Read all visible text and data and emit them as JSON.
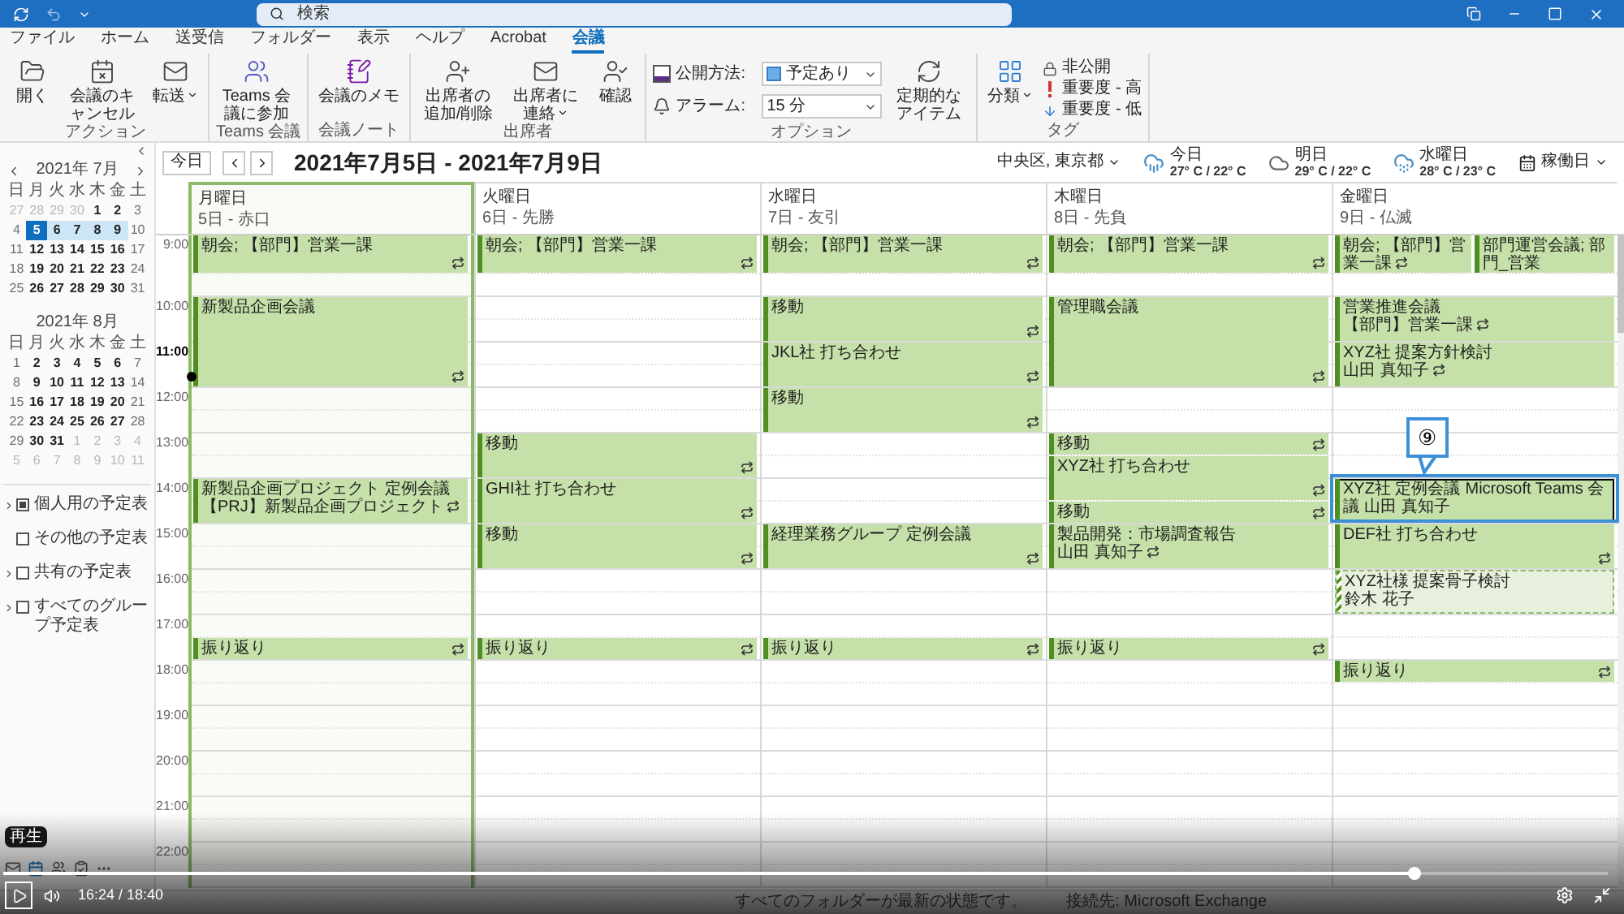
{
  "title_bar": {
    "search": {
      "placeholder": "検索"
    }
  },
  "menu_tabs": [
    {
      "label": "ファイル",
      "selected": false
    },
    {
      "label": "ホーム",
      "selected": false
    },
    {
      "label": "送受信",
      "selected": false
    },
    {
      "label": "フォルダー",
      "selected": false
    },
    {
      "label": "表示",
      "selected": false
    },
    {
      "label": "ヘルプ",
      "selected": false
    },
    {
      "label": "Acrobat",
      "selected": false
    },
    {
      "label": "会議",
      "selected": true
    }
  ],
  "ribbon": {
    "groups": [
      {
        "label": "アクション",
        "buttons": [
          {
            "label": "開く",
            "menu": false
          },
          {
            "label": "会議のキャンセル",
            "menu": false
          },
          {
            "label": "転送",
            "menu": true
          }
        ]
      },
      {
        "label": "Teams 会議",
        "buttons": [
          {
            "label": "Teams 会議に参加",
            "menu": false
          }
        ]
      },
      {
        "label": "会議ノート",
        "buttons": [
          {
            "label": "会議のメモ",
            "menu": false
          }
        ]
      },
      {
        "label": "出席者",
        "buttons": [
          {
            "label": "出席者の追加/削除",
            "menu": false
          },
          {
            "label": "出席者に連絡",
            "menu": true
          },
          {
            "label": "確認",
            "menu": false
          }
        ]
      },
      {
        "label": "オプション",
        "fields": [
          {
            "label": "公開方法:",
            "value": "予定あり"
          },
          {
            "label": "アラーム:",
            "value": "15 分"
          }
        ],
        "buttons": [
          {
            "label": "定期的なアイテム",
            "menu": false
          }
        ]
      },
      {
        "label": "タグ",
        "buttons": [
          {
            "label": "分類",
            "menu": true
          }
        ],
        "small_buttons": [
          {
            "label": "非公開"
          },
          {
            "label": "重要度 - 高"
          },
          {
            "label": "重要度 - 低"
          }
        ]
      }
    ]
  },
  "mini_calendars": [
    {
      "title": "2021年 7月",
      "navigation": true,
      "weekdays": [
        "日",
        "月",
        "火",
        "水",
        "木",
        "金",
        "土"
      ],
      "weeks": [
        [
          {
            "text": "27",
            "in_month": false,
            "selected": false,
            "today": false
          },
          {
            "text": "28",
            "in_month": false,
            "selected": false,
            "today": false
          },
          {
            "text": "29",
            "in_month": false,
            "selected": false,
            "today": false
          },
          {
            "text": "30",
            "in_month": false,
            "selected": false,
            "today": false
          },
          {
            "text": "1",
            "in_month": true,
            "selected": false,
            "today": false
          },
          {
            "text": "2",
            "in_month": true,
            "selected": false,
            "today": false
          },
          {
            "text": "3",
            "in_month": true,
            "selected": false,
            "today": false
          }
        ],
        [
          {
            "text": "4",
            "in_month": true,
            "selected": false,
            "today": false
          },
          {
            "text": "5",
            "in_month": true,
            "selected": true,
            "today": true
          },
          {
            "text": "6",
            "in_month": true,
            "selected": true,
            "today": false
          },
          {
            "text": "7",
            "in_month": true,
            "selected": true,
            "today": false
          },
          {
            "text": "8",
            "in_month": true,
            "selected": true,
            "today": false
          },
          {
            "text": "9",
            "in_month": true,
            "selected": true,
            "today": false
          },
          {
            "text": "10",
            "in_month": true,
            "selected": false,
            "today": false
          }
        ],
        [
          {
            "text": "11",
            "in_month": true,
            "selected": false,
            "today": false
          },
          {
            "text": "12",
            "in_month": true,
            "selected": false,
            "today": false
          },
          {
            "text": "13",
            "in_month": true,
            "selected": false,
            "today": false
          },
          {
            "text": "14",
            "in_month": true,
            "selected": false,
            "today": false
          },
          {
            "text": "15",
            "in_month": true,
            "selected": false,
            "today": false
          },
          {
            "text": "16",
            "in_month": true,
            "selected": false,
            "today": false
          },
          {
            "text": "17",
            "in_month": true,
            "selected": false,
            "today": false
          }
        ],
        [
          {
            "text": "18",
            "in_month": true,
            "selected": false,
            "today": false
          },
          {
            "text": "19",
            "in_month": true,
            "selected": false,
            "today": false
          },
          {
            "text": "20",
            "in_month": true,
            "selected": false,
            "today": false
          },
          {
            "text": "21",
            "in_month": true,
            "selected": false,
            "today": false
          },
          {
            "text": "22",
            "in_month": true,
            "selected": false,
            "today": false
          },
          {
            "text": "23",
            "in_month": true,
            "selected": false,
            "today": false
          },
          {
            "text": "24",
            "in_month": true,
            "selected": false,
            "today": false
          }
        ],
        [
          {
            "text": "25",
            "in_month": true,
            "selected": false,
            "today": false
          },
          {
            "text": "26",
            "in_month": true,
            "selected": false,
            "today": false
          },
          {
            "text": "27",
            "in_month": true,
            "selected": false,
            "today": false
          },
          {
            "text": "28",
            "in_month": true,
            "selected": false,
            "today": false
          },
          {
            "text": "29",
            "in_month": true,
            "selected": false,
            "today": false
          },
          {
            "text": "30",
            "in_month": true,
            "selected": false,
            "today": false
          },
          {
            "text": "31",
            "in_month": true,
            "selected": false,
            "today": false
          }
        ]
      ]
    },
    {
      "title": "2021年 8月",
      "navigation": false,
      "weekdays": [
        "日",
        "月",
        "火",
        "水",
        "木",
        "金",
        "土"
      ],
      "weeks": [
        [
          {
            "text": "1",
            "in_month": true,
            "selected": false,
            "today": false
          },
          {
            "text": "2",
            "in_month": true,
            "selected": false,
            "today": false
          },
          {
            "text": "3",
            "in_month": true,
            "selected": false,
            "today": false
          },
          {
            "text": "4",
            "in_month": true,
            "selected": false,
            "today": false
          },
          {
            "text": "5",
            "in_month": true,
            "selected": false,
            "today": false
          },
          {
            "text": "6",
            "in_month": true,
            "selected": false,
            "today": false
          },
          {
            "text": "7",
            "in_month": true,
            "selected": false,
            "today": false
          }
        ],
        [
          {
            "text": "8",
            "in_month": true,
            "selected": false,
            "today": false
          },
          {
            "text": "9",
            "in_month": true,
            "selected": false,
            "today": false
          },
          {
            "text": "10",
            "in_month": true,
            "selected": false,
            "today": false
          },
          {
            "text": "11",
            "in_month": true,
            "selected": false,
            "today": false
          },
          {
            "text": "12",
            "in_month": true,
            "selected": false,
            "today": false
          },
          {
            "text": "13",
            "in_month": true,
            "selected": false,
            "today": false
          },
          {
            "text": "14",
            "in_month": true,
            "selected": false,
            "today": false
          }
        ],
        [
          {
            "text": "15",
            "in_month": true,
            "selected": false,
            "today": false
          },
          {
            "text": "16",
            "in_month": true,
            "selected": false,
            "today": false
          },
          {
            "text": "17",
            "in_month": true,
            "selected": false,
            "today": false
          },
          {
            "text": "18",
            "in_month": true,
            "selected": false,
            "today": false
          },
          {
            "text": "19",
            "in_month": true,
            "selected": false,
            "today": false
          },
          {
            "text": "20",
            "in_month": true,
            "selected": false,
            "today": false
          },
          {
            "text": "21",
            "in_month": true,
            "selected": false,
            "today": false
          }
        ],
        [
          {
            "text": "22",
            "in_month": true,
            "selected": false,
            "today": false
          },
          {
            "text": "23",
            "in_month": true,
            "selected": false,
            "today": false
          },
          {
            "text": "24",
            "in_month": true,
            "selected": false,
            "today": false
          },
          {
            "text": "25",
            "in_month": true,
            "selected": false,
            "today": false
          },
          {
            "text": "26",
            "in_month": true,
            "selected": false,
            "today": false
          },
          {
            "text": "27",
            "in_month": true,
            "selected": false,
            "today": false
          },
          {
            "text": "28",
            "in_month": true,
            "selected": false,
            "today": false
          }
        ],
        [
          {
            "text": "29",
            "in_month": true,
            "selected": false,
            "today": false
          },
          {
            "text": "30",
            "in_month": true,
            "selected": false,
            "today": false
          },
          {
            "text": "31",
            "in_month": true,
            "selected": false,
            "today": false
          },
          {
            "text": "1",
            "in_month": false,
            "selected": false,
            "today": false
          },
          {
            "text": "2",
            "in_month": false,
            "selected": false,
            "today": false
          },
          {
            "text": "3",
            "in_month": false,
            "selected": false,
            "today": false
          },
          {
            "text": "4",
            "in_month": false,
            "selected": false,
            "today": false
          }
        ],
        [
          {
            "text": "5",
            "in_month": false,
            "selected": false,
            "today": false
          },
          {
            "text": "6",
            "in_month": false,
            "selected": false,
            "today": false
          },
          {
            "text": "7",
            "in_month": false,
            "selected": false,
            "today": false
          },
          {
            "text": "8",
            "in_month": false,
            "selected": false,
            "today": false
          },
          {
            "text": "9",
            "in_month": false,
            "selected": false,
            "today": false
          },
          {
            "text": "10",
            "in_month": false,
            "selected": false,
            "today": false
          },
          {
            "text": "11",
            "in_month": false,
            "selected": false,
            "today": false
          }
        ]
      ]
    }
  ],
  "calendar_folders": [
    {
      "label": "個人用の予定表",
      "checked": true,
      "expandable": true
    },
    {
      "label": "その他の予定表",
      "checked": false,
      "expandable": false
    },
    {
      "label": "共有の予定表",
      "checked": false,
      "expandable": true
    },
    {
      "label": "すべてのグループ予定表",
      "checked": false,
      "expandable": true
    }
  ],
  "toolbar": {
    "today": "今日",
    "range": "2021年7月5日 - 2021年7月9日",
    "location": "中央区, 東京都",
    "weather": [
      {
        "day": "今日",
        "temp": "27° C / 22° C"
      },
      {
        "day": "明日",
        "temp": "29° C / 22° C"
      },
      {
        "day": "水曜日",
        "temp": "28° C / 23° C"
      }
    ],
    "view": "稼働日"
  },
  "times": [
    {
      "text": "9:00",
      "current": false
    },
    {
      "text": "10:00",
      "current": false
    },
    {
      "text": "11:00",
      "current": true
    },
    {
      "text": "12:00",
      "current": false
    },
    {
      "text": "13:00",
      "current": false
    },
    {
      "text": "14:00",
      "current": false
    },
    {
      "text": "15:00",
      "current": false
    },
    {
      "text": "16:00",
      "current": false
    },
    {
      "text": "17:00",
      "current": false
    },
    {
      "text": "18:00",
      "current": false
    },
    {
      "text": "19:00",
      "current": false
    },
    {
      "text": "20:00",
      "current": false
    },
    {
      "text": "21:00",
      "current": false
    },
    {
      "text": "22:00",
      "current": false
    }
  ],
  "days": [
    {
      "weekday": "月曜日",
      "date": "5日 - 赤口",
      "today": true,
      "slots": [
        {
          "kind": "busy",
          "lines": [
            "朝会; 【部門】営業一課"
          ],
          "recurring": true,
          "selected": false
        },
        {
          "kind": "free"
        },
        {
          "kind": "busy",
          "lines": [
            "新製品企画会議"
          ],
          "recurring": true,
          "selected": false
        },
        {
          "kind": "continued"
        },
        {
          "kind": "continued"
        },
        {
          "kind": "continued"
        },
        {
          "kind": "free"
        },
        {
          "kind": "free"
        },
        {
          "kind": "free"
        },
        {
          "kind": "free"
        },
        {
          "kind": "busy",
          "lines": [
            "新製品企画プロジェクト 定例会議",
            "【PRJ】新製品企画プロジェクト"
          ],
          "recurring": true,
          "selected": false
        },
        {
          "kind": "continued"
        },
        {
          "kind": "free"
        },
        {
          "kind": "free"
        },
        {
          "kind": "free"
        },
        {
          "kind": "free"
        },
        {
          "kind": "free"
        },
        {
          "kind": "busy",
          "lines": [
            "振り返り"
          ],
          "recurring": true,
          "selected": false
        }
      ]
    },
    {
      "weekday": "火曜日",
      "date": "6日 - 先勝",
      "today": false,
      "slots": [
        {
          "kind": "busy",
          "lines": [
            "朝会; 【部門】営業一課"
          ],
          "recurring": true,
          "selected": false
        },
        {
          "kind": "free"
        },
        {
          "kind": "free"
        },
        {
          "kind": "free"
        },
        {
          "kind": "free"
        },
        {
          "kind": "free"
        },
        {
          "kind": "free"
        },
        {
          "kind": "free"
        },
        {
          "kind": "busy",
          "lines": [
            "移動"
          ],
          "recurring": true,
          "selected": false
        },
        {
          "kind": "continued"
        },
        {
          "kind": "busy",
          "lines": [
            "GHI社 打ち合わせ"
          ],
          "recurring": true,
          "selected": false
        },
        {
          "kind": "continued"
        },
        {
          "kind": "busy",
          "lines": [
            "移動"
          ],
          "recurring": true,
          "selected": false
        },
        {
          "kind": "continued"
        },
        {
          "kind": "free"
        },
        {
          "kind": "free"
        },
        {
          "kind": "free"
        },
        {
          "kind": "busy",
          "lines": [
            "振り返り"
          ],
          "recurring": true,
          "selected": false
        }
      ]
    },
    {
      "weekday": "水曜日",
      "date": "7日 - 友引",
      "today": false,
      "slots": [
        {
          "kind": "busy",
          "lines": [
            "朝会; 【部門】営業一課"
          ],
          "recurring": true,
          "selected": false
        },
        {
          "kind": "free"
        },
        {
          "kind": "busy",
          "lines": [
            "移動"
          ],
          "recurring": true,
          "selected": false
        },
        {
          "kind": "continued"
        },
        {
          "kind": "busy",
          "lines": [
            "JKL社 打ち合わせ"
          ],
          "recurring": true,
          "selected": false
        },
        {
          "kind": "continued"
        },
        {
          "kind": "busy",
          "lines": [
            "移動"
          ],
          "recurring": true,
          "selected": false
        },
        {
          "kind": "continued"
        },
        {
          "kind": "free"
        },
        {
          "kind": "free"
        },
        {
          "kind": "free"
        },
        {
          "kind": "free"
        },
        {
          "kind": "busy",
          "lines": [
            "経理業務グループ 定例会議"
          ],
          "recurring": true,
          "selected": false
        },
        {
          "kind": "continued"
        },
        {
          "kind": "free"
        },
        {
          "kind": "free"
        },
        {
          "kind": "free"
        },
        {
          "kind": "busy",
          "lines": [
            "振り返り"
          ],
          "recurring": true,
          "selected": false
        }
      ]
    },
    {
      "weekday": "木曜日",
      "date": "8日 - 先負",
      "today": false,
      "slots": [
        {
          "kind": "busy",
          "lines": [
            "朝会; 【部門】営業一課"
          ],
          "recurring": true,
          "selected": false
        },
        {
          "kind": "free"
        },
        {
          "kind": "busy",
          "lines": [
            "管理職会議"
          ],
          "recurring": true,
          "selected": false
        },
        {
          "kind": "continued"
        },
        {
          "kind": "continued"
        },
        {
          "kind": "continued"
        },
        {
          "kind": "free"
        },
        {
          "kind": "free"
        },
        {
          "kind": "busy",
          "lines": [
            "移動"
          ],
          "recurring": true,
          "selected": false
        },
        {
          "kind": "busy",
          "lines": [
            "XYZ社 打ち合わせ"
          ],
          "recurring": true,
          "selected": false
        },
        {
          "kind": "continued"
        },
        {
          "kind": "busy",
          "lines": [
            "移動"
          ],
          "recurring": true,
          "selected": false
        },
        {
          "kind": "busy",
          "lines": [
            "製品開発：市場調査報告",
            "山田 真知子"
          ],
          "recurring": true,
          "selected": false
        },
        {
          "kind": "continued"
        },
        {
          "kind": "free"
        },
        {
          "kind": "free"
        },
        {
          "kind": "free"
        },
        {
          "kind": "busy",
          "lines": [
            "振り返り"
          ],
          "recurring": true,
          "selected": false
        }
      ]
    },
    {
      "weekday": "金曜日",
      "date": "9日 - 仏滅",
      "today": false,
      "slots": [
        {
          "kind": "split",
          "events": [
            {
              "kind": "busy",
              "lines": [
                "朝会; 【部門】営業一課"
              ],
              "recurring": true,
              "selected": false
            },
            {
              "kind": "busy",
              "lines": [
                "部門運営会議; 部門_営業"
              ],
              "recurring": false,
              "selected": false
            }
          ]
        },
        {
          "kind": "free"
        },
        {
          "kind": "busy",
          "lines": [
            "営業推進会議",
            "【部門】営業一課"
          ],
          "recurring": true,
          "selected": false
        },
        {
          "kind": "continued"
        },
        {
          "kind": "busy",
          "lines": [
            "XYZ社 提案方針検討",
            "山田 真知子"
          ],
          "recurring": true,
          "selected": false
        },
        {
          "kind": "continued"
        },
        {
          "kind": "free"
        },
        {
          "kind": "free"
        },
        {
          "kind": "free"
        },
        {
          "kind": "free"
        },
        {
          "kind": "busy",
          "lines": [
            "XYZ社 定例会議",
            "Microsoft Teams 会議",
            "山田 真知子"
          ],
          "recurring": false,
          "selected": true,
          "callout": "⑨"
        },
        {
          "kind": "continued"
        },
        {
          "kind": "busy",
          "lines": [
            "DEF社 打ち合わせ"
          ],
          "recurring": true,
          "selected": false
        },
        {
          "kind": "continued"
        },
        {
          "kind": "tentative",
          "lines": [
            "XYZ社様 提案骨子検討",
            "鈴木 花子"
          ],
          "recurring": false,
          "selected": false
        },
        {
          "kind": "continued"
        },
        {
          "kind": "free"
        },
        {
          "kind": "free"
        },
        {
          "kind": "busy",
          "lines": [
            "振り返り"
          ],
          "recurring": true,
          "selected": false
        }
      ]
    }
  ],
  "status_bar": {
    "sync": "すべてのフォルダーが最新の状態です。",
    "connection": "接続先: Microsoft Exchange"
  },
  "player": {
    "tooltip": "再生",
    "time": "16:24 / 18:40",
    "progress": {
      "level": 0.88
    }
  }
}
